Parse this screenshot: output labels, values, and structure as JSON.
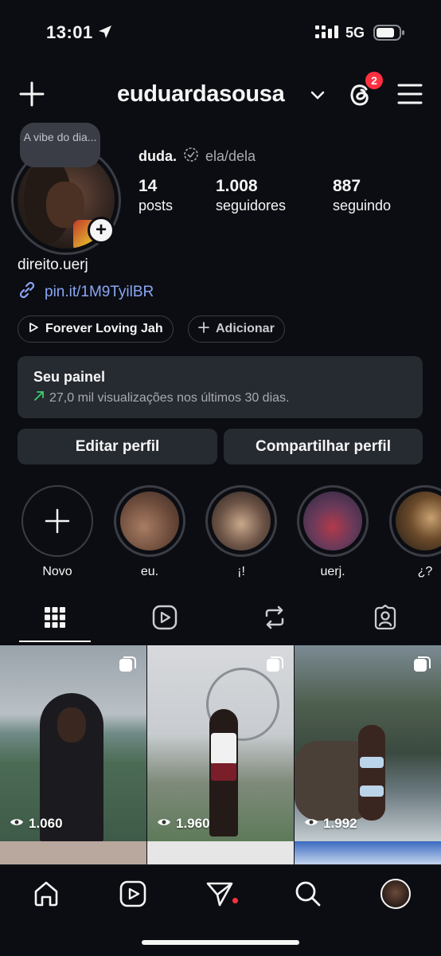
{
  "status_bar": {
    "time": "13:01",
    "network": "5G"
  },
  "header": {
    "username": "euduardasousa",
    "threads_badge": "2"
  },
  "profile": {
    "note": "A vibe do dia...",
    "display_name": "duda.",
    "pronouns": "ela/dela",
    "stats": [
      {
        "value": "14",
        "label": "posts"
      },
      {
        "value": "1.008",
        "label": "seguidores"
      },
      {
        "value": "887",
        "label": "seguindo"
      }
    ],
    "bio": "direito.uerj",
    "link": "pin.it/1M9TyilBR",
    "music_chip": "Forever Loving Jah",
    "add_chip": "Adicionar"
  },
  "dashboard": {
    "title": "Seu painel",
    "subtitle": "27,0 mil visualizações nos últimos 30 dias."
  },
  "actions": {
    "edit": "Editar perfil",
    "share": "Compartilhar perfil"
  },
  "highlights": [
    {
      "label": "Novo"
    },
    {
      "label": "eu."
    },
    {
      "label": "¡!"
    },
    {
      "label": "uerj."
    },
    {
      "label": "¿?"
    }
  ],
  "tabs": [
    "grid-icon",
    "reels-icon",
    "reposts-icon",
    "tagged-icon"
  ],
  "posts": [
    {
      "views": "1.060"
    },
    {
      "views": "1.960"
    },
    {
      "views": "1.992"
    }
  ],
  "colors": {
    "background": "#0b0d12",
    "surface": "#262a31",
    "link": "#8aa6f5",
    "badge": "#ff3040",
    "trend": "#3ecf6e"
  }
}
